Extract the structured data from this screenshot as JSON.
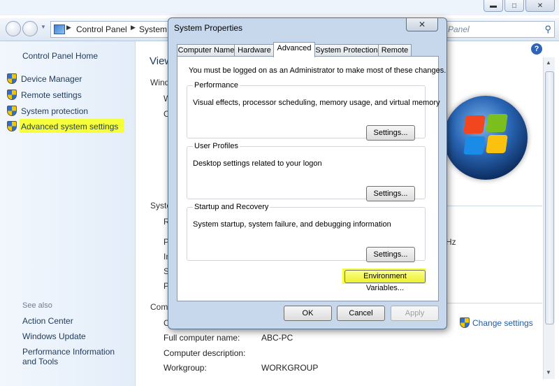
{
  "background": {
    "address": {
      "crumb1": "Control Panel",
      "crumb2": "System"
    },
    "search": {
      "text": "Panel"
    },
    "sidebar": {
      "home": "Control Panel Home",
      "items": [
        "Device Manager",
        "Remote settings",
        "System protection",
        "Advanced system settings"
      ],
      "see_also": "See also",
      "see_also_items": [
        "Action Center",
        "Windows Update",
        "Performance Information and Tools"
      ]
    },
    "main": {
      "heading": "View",
      "frag_windows": "Windo",
      "frag_w": "W",
      "frag_c": "C",
      "frag_system": "Syste",
      "frag_r": "R",
      "frag_p": "P",
      "frag_i": "In",
      "frag_s": "S",
      "frag_p2": "P",
      "frag_hz": "Hz",
      "frag_computer": "Comp",
      "frag_c2": "C",
      "change_settings": "Change settings",
      "rows": [
        {
          "label": "Full computer name:",
          "value": "ABC-PC"
        },
        {
          "label": "Computer description:",
          "value": ""
        },
        {
          "label": "Workgroup:",
          "value": "WORKGROUP"
        }
      ]
    }
  },
  "dialog": {
    "title": "System Properties",
    "tabs": [
      "Computer Name",
      "Hardware",
      "Advanced",
      "System Protection",
      "Remote"
    ],
    "active_tab": "Advanced",
    "admin_note": "You must be logged on as an Administrator to make most of these changes.",
    "groups": [
      {
        "title": "Performance",
        "desc": "Visual effects, processor scheduling, memory usage, and virtual memory",
        "button": "Settings..."
      },
      {
        "title": "User Profiles",
        "desc": "Desktop settings related to your logon",
        "button": "Settings..."
      },
      {
        "title": "Startup and Recovery",
        "desc": "System startup, system failure, and debugging information",
        "button": "Settings..."
      }
    ],
    "env_button": "Environment Variables...",
    "ok": "OK",
    "cancel": "Cancel",
    "apply": "Apply"
  },
  "colors": {
    "highlight": "#f6ff3a",
    "link": "#1e395b",
    "dialog_frame": "#c8d8ec"
  }
}
